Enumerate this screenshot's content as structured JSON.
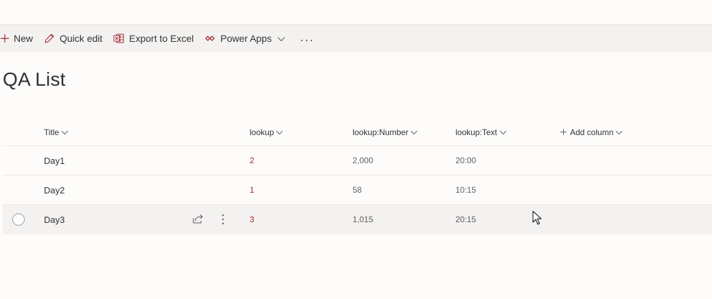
{
  "command_bar": {
    "new_label": "New",
    "quick_edit_label": "Quick edit",
    "export_label": "Export to Excel",
    "power_apps_label": "Power Apps",
    "more_label": "···",
    "icons": [
      "plus-icon",
      "pencil-icon",
      "excel-icon",
      "power-apps-icon",
      "chevron-down-icon",
      "more-icon"
    ]
  },
  "list": {
    "title": "QA List",
    "columns": {
      "title": "Title",
      "lookup": "lookup",
      "lookup_number": "lookup:Number",
      "lookup_text": "lookup:Text",
      "add_column": "Add column"
    },
    "rows": [
      {
        "title": "Day1",
        "lookup": "2",
        "lookup_number": "2,000",
        "lookup_text": "20:00"
      },
      {
        "title": "Day2",
        "lookup": "1",
        "lookup_number": "58",
        "lookup_text": "10:15"
      },
      {
        "title": "Day3",
        "lookup": "3",
        "lookup_number": "1,015",
        "lookup_text": "20:15"
      }
    ]
  },
  "colors": {
    "accent": "#a4262c",
    "command_bar_bg": "#f3f2f1",
    "hover_row_bg": "#f3f2f1"
  }
}
